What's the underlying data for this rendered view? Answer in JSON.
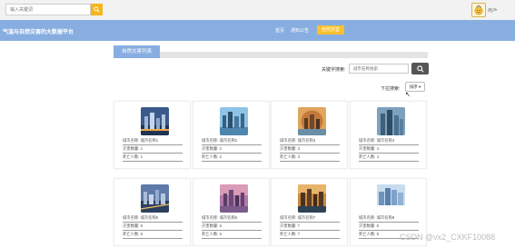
{
  "topbar": {
    "search_placeholder": "输入关键词",
    "user_name": "用户"
  },
  "header": {
    "title": "气温与自然灾害的大数据平台",
    "nav": [
      {
        "label": "首页"
      },
      {
        "label": "通知公告"
      },
      {
        "label": "自然灾害"
      }
    ]
  },
  "section": {
    "title": "自然灾害列表"
  },
  "filter": {
    "keyword_label": "关键字搜索:",
    "keyword_placeholder": "城市名称搜索",
    "sort_label": "下拉搜索:",
    "sort_value": "排序"
  },
  "cards": [
    {
      "city": "城市名称: 城市名称1",
      "count": "灾害数量: 1",
      "deaths": "死亡人数: 1"
    },
    {
      "city": "城市名称: 城市名称2",
      "count": "灾害数量: 2",
      "deaths": "死亡人数: 2"
    },
    {
      "city": "城市名称: 城市名称3",
      "count": "灾害数量: 3",
      "deaths": "死亡人数: 3"
    },
    {
      "city": "城市名称: 城市名称4",
      "count": "灾害数量: 4",
      "deaths": "死亡人数: 4"
    },
    {
      "city": "城市名称: 城市名称5",
      "count": "灾害数量: 5",
      "deaths": "死亡人数: 5"
    },
    {
      "city": "城市名称: 城市名称6",
      "count": "灾害数量: 6",
      "deaths": "死亡人数: 6"
    },
    {
      "city": "城市名称: 城市名称7",
      "count": "灾害数量: 7",
      "deaths": "死亡人数: 7"
    },
    {
      "city": "城市名称: 城市名称8",
      "count": "灾害数量: 8",
      "deaths": "死亡人数: 8"
    }
  ],
  "watermark": "CSDN @vx2_CXKF10088",
  "colors": {
    "header_bg": "#88aee1",
    "accent": "#fbc02d",
    "search_button": "#f5b619",
    "dark_button": "#555555"
  },
  "icons": {
    "search": "search-icon",
    "avatar": "user-avatar-icon",
    "caret": "chevron-down-icon"
  }
}
